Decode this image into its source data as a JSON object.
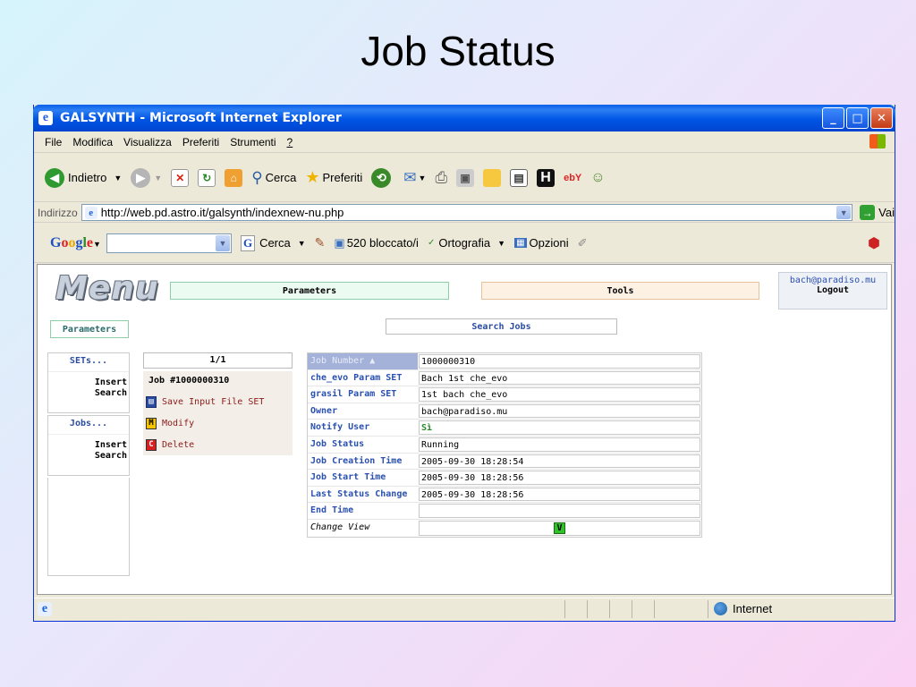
{
  "slide": {
    "title": "Job Status"
  },
  "window": {
    "title": "GALSYNTH - Microsoft Internet Explorer",
    "controls": {
      "minimize": "_",
      "maximize": "□",
      "close": "✕"
    }
  },
  "menubar": {
    "items": [
      "File",
      "Modifica",
      "Visualizza",
      "Preferiti",
      "Strumenti",
      "?"
    ]
  },
  "toolbar": {
    "back_label": "Indietro",
    "search_label": "Cerca",
    "favorites_label": "Preferiti"
  },
  "addressbar": {
    "label": "Indirizzo",
    "url": "http://web.pd.astro.it/galsynth/indexnew-nu.php",
    "go_label": "Vai"
  },
  "googlebar": {
    "logo": "Google",
    "search_label": "Cerca",
    "blocked_label": "520 bloccato/i",
    "spell_label": "Ortografia",
    "options_label": "Opzioni"
  },
  "page": {
    "logo_text": "Menu",
    "tab_parameters": "Parameters",
    "tab_tools": "Tools",
    "user_email": "bach@paradiso.mu",
    "logout_label": "Logout",
    "sidebar": {
      "parameters_label": "Parameters",
      "sets_heading": "SETs...",
      "sets_insert": "Insert",
      "sets_search": "Search",
      "jobs_heading": "Jobs...",
      "jobs_insert": "Insert",
      "jobs_search": "Search"
    },
    "search_jobs_label": "Search Jobs",
    "job_panel": {
      "pager": "1/1",
      "job_id": "Job #1000000310",
      "actions": [
        {
          "icon": "save",
          "label": "Save Input File SET"
        },
        {
          "icon": "M",
          "label": "Modify"
        },
        {
          "icon": "C",
          "label": "Delete"
        }
      ]
    },
    "job_details": {
      "rows": [
        {
          "label": "Job Number ▲",
          "value": "1000000310"
        },
        {
          "label": "che_evo Param SET",
          "value": "Bach 1st che_evo"
        },
        {
          "label": "grasil Param SET",
          "value": "1st bach che_evo"
        },
        {
          "label": "Owner",
          "value": "bach@paradiso.mu"
        },
        {
          "label": "Notify User",
          "value": "Sì"
        },
        {
          "label": "Job Status",
          "value": "Running"
        },
        {
          "label": "Job Creation Time",
          "value": "2005-09-30 18:28:54"
        },
        {
          "label": "Job Start Time",
          "value": "2005-09-30 18:28:56"
        },
        {
          "label": "Last Status Change",
          "value": "2005-09-30 18:28:56"
        },
        {
          "label": "End Time",
          "value": ""
        }
      ],
      "change_view_label": "Change View",
      "change_view_button": "V"
    }
  },
  "statusbar": {
    "zone_label": "Internet"
  },
  "colors": {
    "titlebar": "#0055e5",
    "link_blue": "#2a50b0",
    "notify_green": "#2a8a2a"
  }
}
